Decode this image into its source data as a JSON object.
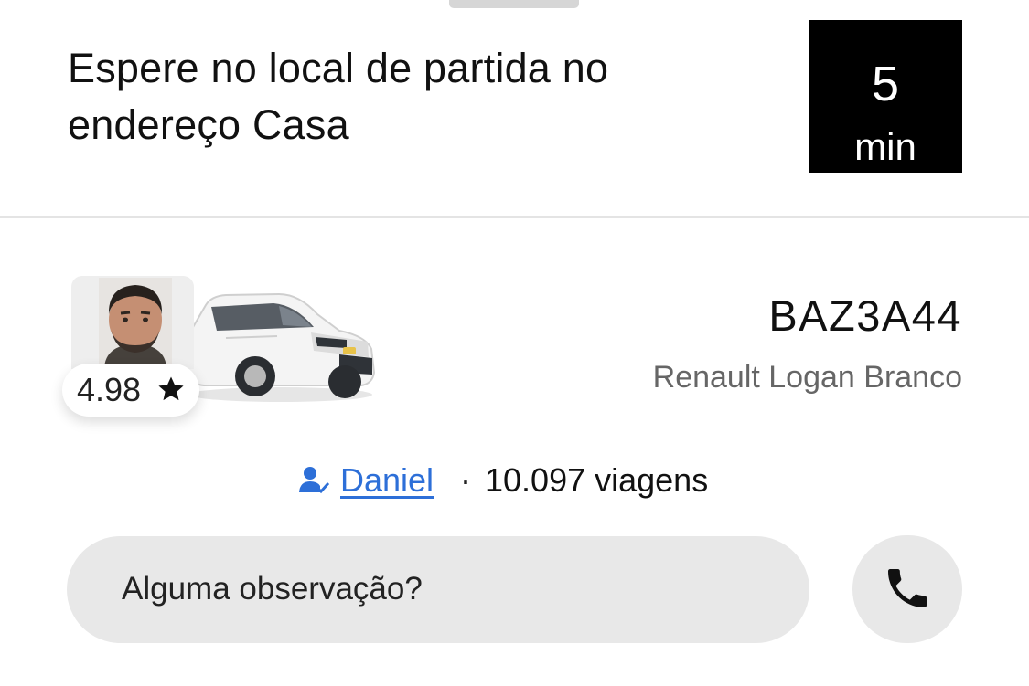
{
  "header": {
    "title": "Espere no local de partida no endereço Casa",
    "eta": {
      "value": "5",
      "unit": "min"
    }
  },
  "driver": {
    "rating": "4.98",
    "name": "Daniel",
    "separator": "·",
    "trips": "10.097 viagens",
    "icons": {
      "avatar": "driver-photo",
      "verified": "verified-person-icon",
      "rating": "star-icon"
    }
  },
  "vehicle": {
    "plate": "BAZ3A44",
    "model": "Renault Logan Branco",
    "icon": "car-image"
  },
  "actions": {
    "note_placeholder": "Alguma observação?",
    "call_icon": "phone-icon"
  },
  "colors": {
    "eta_background": "#000000",
    "link": "#2d6fd8",
    "pill_background": "#e8e8e8"
  }
}
